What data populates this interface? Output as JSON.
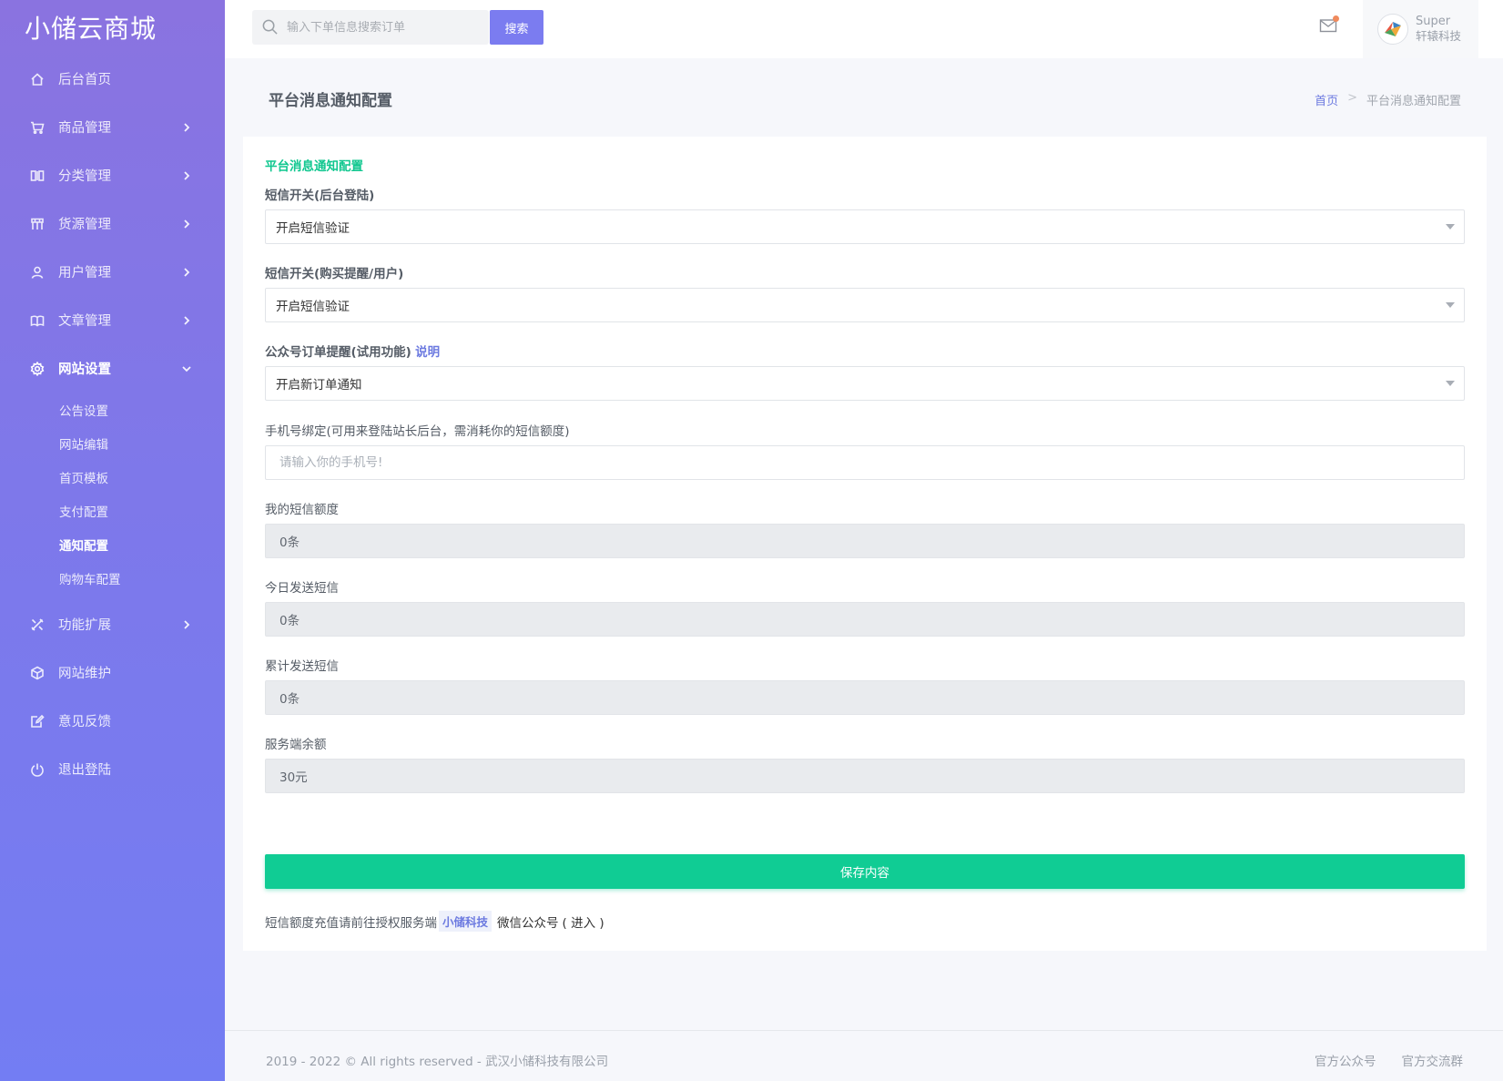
{
  "brand": "小储云商城",
  "sidebar": {
    "items": [
      {
        "label": "后台首页",
        "icon": "home-icon"
      },
      {
        "label": "商品管理",
        "icon": "cart-icon"
      },
      {
        "label": "分类管理",
        "icon": "columns-icon"
      },
      {
        "label": "货源管理",
        "icon": "store-icon"
      },
      {
        "label": "用户管理",
        "icon": "user-icon"
      },
      {
        "label": "文章管理",
        "icon": "book-icon"
      },
      {
        "label": "网站设置",
        "icon": "gear-icon"
      },
      {
        "label": "功能扩展",
        "icon": "tools-icon"
      },
      {
        "label": "网站维护",
        "icon": "cube-icon"
      },
      {
        "label": "意见反馈",
        "icon": "edit-icon"
      },
      {
        "label": "退出登陆",
        "icon": "power-icon"
      }
    ],
    "submenu": [
      "公告设置",
      "网站编辑",
      "首页模板",
      "支付配置",
      "通知配置",
      "购物车配置"
    ],
    "active_sub": "通知配置"
  },
  "header": {
    "search_placeholder": "输入下单信息搜索订单",
    "search_button": "搜索",
    "user_name": "Super",
    "user_org": "轩辕科技"
  },
  "page": {
    "title": "平台消息通知配置",
    "breadcrumb_home": "首页",
    "breadcrumb_sep": ">",
    "breadcrumb_current": "平台消息通知配置"
  },
  "form": {
    "card_title": "平台消息通知配置",
    "sms_login_label": "短信开关(后台登陆)",
    "sms_login_value": "开启短信验证",
    "sms_buy_label": "短信开关(购买提醒/用户)",
    "sms_buy_value": "开启短信验证",
    "wechat_label": "公众号订单提醒(试用功能)",
    "wechat_link": "说明",
    "wechat_value": "开启新订单通知",
    "phone_label": "手机号绑定(可用来登陆站长后台，需消耗你的短信额度)",
    "phone_placeholder": "请输入你的手机号!",
    "quota_label": "我的短信额度",
    "quota_value": "0条",
    "today_label": "今日发送短信",
    "today_value": "0条",
    "total_label": "累计发送短信",
    "total_value": "0条",
    "balance_label": "服务端余额",
    "balance_value": "30元",
    "save_button": "保存内容",
    "note_prefix": "短信额度充值请前往授权服务端",
    "note_tag": "小储科技",
    "note_suffix": "微信公众号",
    "note_enter": "( 进入 )"
  },
  "footer": {
    "copyright": "2019 - 2022 © All rights reserved - 武汉小储科技有限公司",
    "link1": "官方公众号",
    "link2": "官方交流群"
  },
  "colors": {
    "accent": "#7b7cf0",
    "success": "#10cc94",
    "sidebar_top": "#8a73e0",
    "sidebar_bottom": "#737df3"
  }
}
